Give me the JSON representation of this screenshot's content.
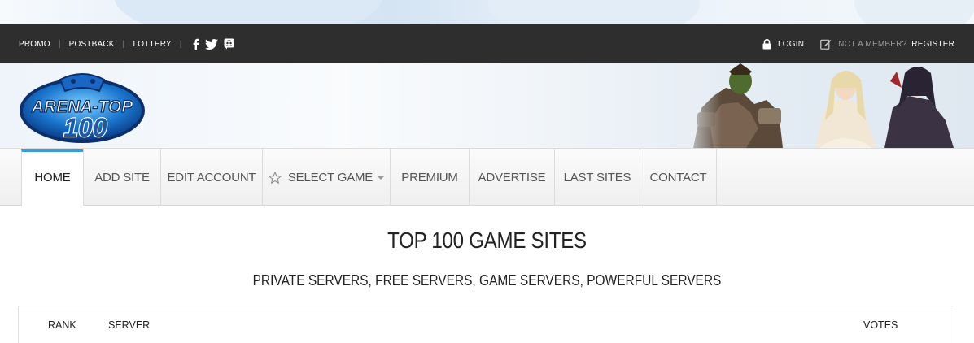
{
  "topbar": {
    "links": [
      "PROMO",
      "POSTBACK",
      "LOTTERY"
    ],
    "social_icons": [
      "facebook-icon",
      "twitter-icon",
      "discord-icon"
    ],
    "login_label": "LOGIN",
    "not_member_label": "NOT A MEMBER?",
    "register_label": "REGISTER"
  },
  "banner": {
    "logo_line1": "ARENA-TOP",
    "logo_line2": "100"
  },
  "nav": {
    "items": [
      {
        "label": "HOME",
        "active": true
      },
      {
        "label": "ADD SITE"
      },
      {
        "label": "EDIT ACCOUNT"
      },
      {
        "label": "SELECT GAME",
        "icon": "star-icon",
        "dropdown": true
      },
      {
        "label": "PREMIUM"
      },
      {
        "label": "ADVERTISE"
      },
      {
        "label": "LAST SITES"
      },
      {
        "label": "CONTACT"
      }
    ]
  },
  "main": {
    "title": "TOP 100 GAME SITES",
    "subtitle": "PRIVATE SERVERS, FREE SERVERS, GAME SERVERS, POWERFUL SERVERS"
  },
  "table": {
    "columns": [
      "RANK",
      "SERVER",
      "VOTES"
    ]
  },
  "colors": {
    "topbar_bg": "#2e2e2e",
    "nav_active_accent": "#3d9bd6",
    "logo_blue": "#1763b8"
  }
}
